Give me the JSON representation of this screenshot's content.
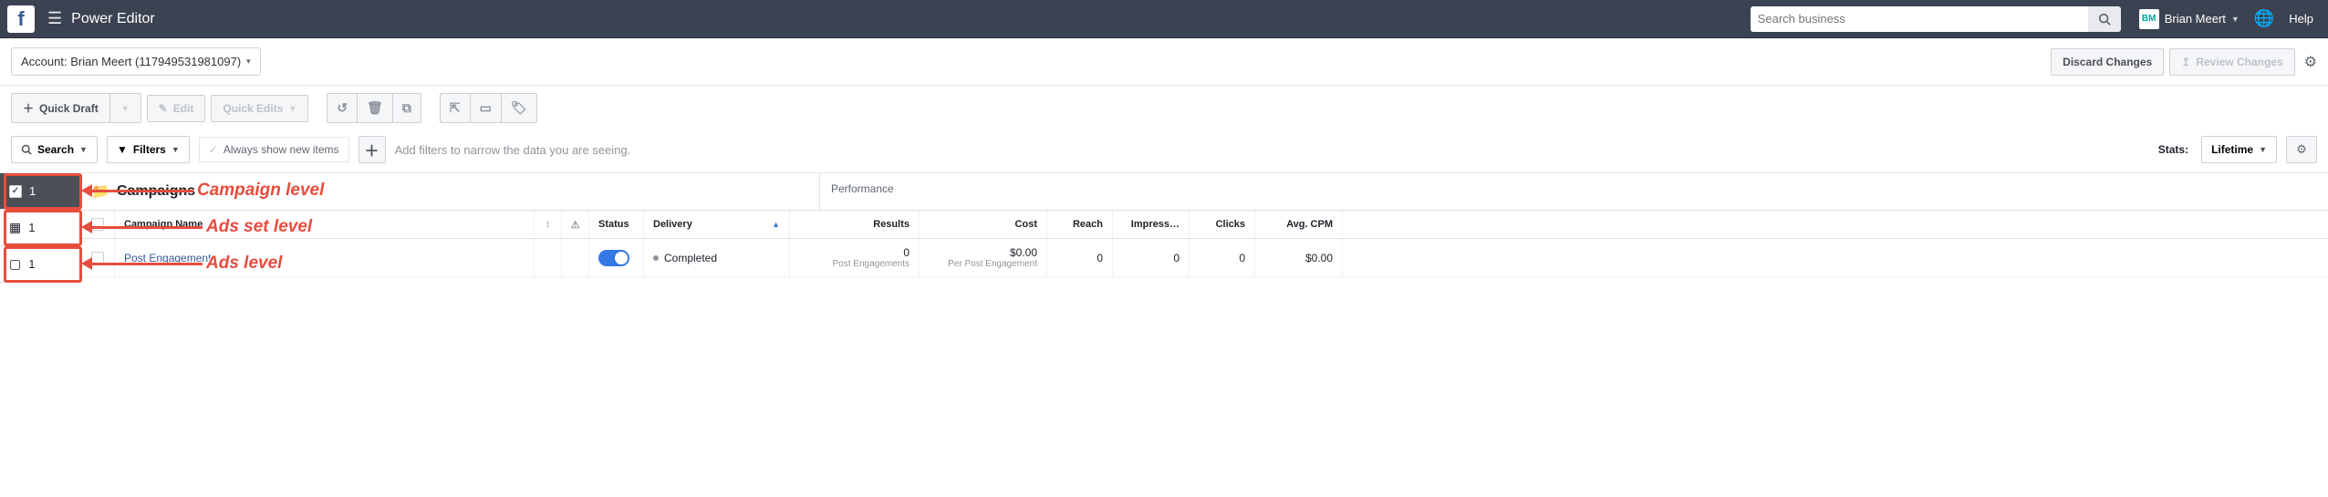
{
  "nav": {
    "app_title": "Power Editor",
    "search_placeholder": "Search business",
    "user_initials": "BM",
    "user_name": "Brian Meert",
    "help_label": "Help"
  },
  "account": {
    "label_prefix": "Account:",
    "account_text": "Brian Meert (117949531981097)",
    "discard_label": "Discard Changes",
    "review_label": "Review Changes"
  },
  "toolbar": {
    "quick_draft": "Quick Draft",
    "edit": "Edit",
    "quick_edits": "Quick Edits"
  },
  "filters": {
    "search_label": "Search",
    "filters_label": "Filters",
    "always_show_label": "Always show new items",
    "placeholder": "Add filters to narrow the data you are seeing.",
    "stats_label": "Stats:",
    "stats_value": "Lifetime"
  },
  "tabs": {
    "campaign_count": "1",
    "adset_count": "1",
    "ads_count": "1"
  },
  "annotations": {
    "campaign": "Campaign level",
    "adset": "Ads set level",
    "ads": "Ads level"
  },
  "grid": {
    "section_title": "Campaigns",
    "perf_title": "Performance",
    "headers": {
      "name": "Campaign Name",
      "status": "Status",
      "delivery": "Delivery",
      "results": "Results",
      "cost": "Cost",
      "reach": "Reach",
      "impressions": "Impress…",
      "clicks": "Clicks",
      "cpm": "Avg. CPM"
    },
    "row": {
      "name": "Post Engagement",
      "delivery": "Completed",
      "results_value": "0",
      "results_label": "Post Engagements",
      "cost_value": "$0.00",
      "cost_label": "Per Post Engagement",
      "reach": "0",
      "impressions": "0",
      "clicks": "0",
      "cpm": "$0.00"
    }
  }
}
